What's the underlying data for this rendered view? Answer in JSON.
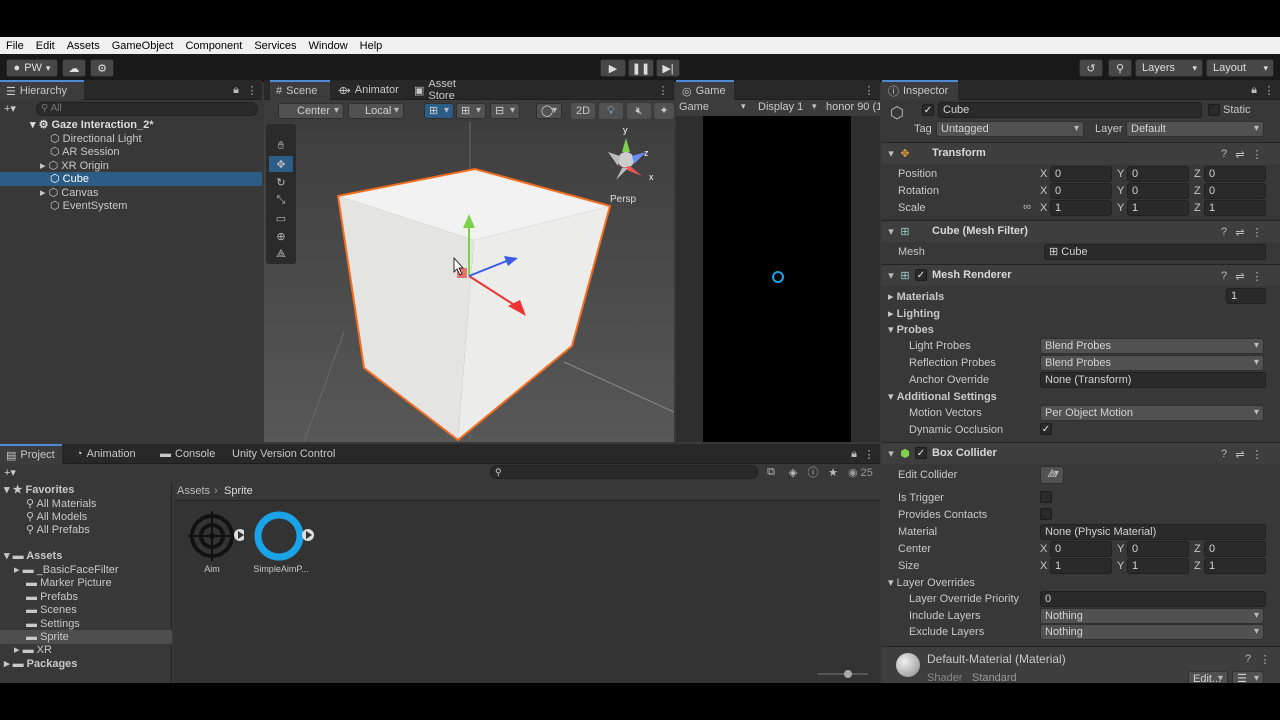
{
  "menu": [
    "File",
    "Edit",
    "Assets",
    "GameObject",
    "Component",
    "Services",
    "Window",
    "Help"
  ],
  "toolbar": {
    "account": "PW",
    "layers": "Layers",
    "layout": "Layout"
  },
  "hierarchy": {
    "tab": "Hierarchy",
    "search_placeholder": "All",
    "scene": "Gaze Interaction_2*",
    "items": [
      "Directional Light",
      "AR Session",
      "XR Origin",
      "Cube",
      "Canvas",
      "EventSystem"
    ]
  },
  "scene": {
    "tabs": [
      "Scene",
      "Animator",
      "Asset Store"
    ],
    "pivot": "Center",
    "space": "Local",
    "mode2d": "2D",
    "persp": "Persp",
    "axes": {
      "y": "y",
      "z": "z",
      "x": "x"
    }
  },
  "game": {
    "tab": "Game",
    "view": "Game",
    "display": "Display 1",
    "device": "honor 90 (1"
  },
  "inspector": {
    "tab": "Inspector",
    "name": "Cube",
    "static": "Static",
    "tag_label": "Tag",
    "tag": "Untagged",
    "layer_label": "Layer",
    "layer": "Default",
    "transform": {
      "title": "Transform",
      "rows": [
        {
          "label": "Position",
          "x": "0",
          "y": "0",
          "z": "0"
        },
        {
          "label": "Rotation",
          "x": "0",
          "y": "0",
          "z": "0"
        },
        {
          "label": "Scale",
          "x": "1",
          "y": "1",
          "z": "1"
        }
      ]
    },
    "mesh_filter": {
      "title": "Cube (Mesh Filter)",
      "mesh_label": "Mesh",
      "mesh": "Cube"
    },
    "mesh_renderer": {
      "title": "Mesh Renderer",
      "materials": "Materials",
      "materials_count": "1",
      "lighting": "Lighting",
      "probes": "Probes",
      "light_probes_label": "Light Probes",
      "light_probes": "Blend Probes",
      "reflection_probes_label": "Reflection Probes",
      "reflection_probes": "Blend Probes",
      "anchor_label": "Anchor Override",
      "anchor": "None (Transform)",
      "additional": "Additional Settings",
      "motion_label": "Motion Vectors",
      "motion": "Per Object Motion",
      "occlusion_label": "Dynamic Occlusion"
    },
    "box_collider": {
      "title": "Box Collider",
      "edit_label": "Edit Collider",
      "trigger_label": "Is Trigger",
      "contacts_label": "Provides Contacts",
      "material_label": "Material",
      "material": "None (Physic Material)",
      "center_label": "Center",
      "center": {
        "x": "0",
        "y": "0",
        "z": "0"
      },
      "size_label": "Size",
      "size": {
        "x": "1",
        "y": "1",
        "z": "1"
      },
      "overrides": "Layer Overrides",
      "priority_label": "Layer Override Priority",
      "priority": "0",
      "include_label": "Include Layers",
      "include": "Nothing",
      "exclude_label": "Exclude Layers",
      "exclude": "Nothing"
    },
    "material": {
      "title": "Default-Material (Material)",
      "shader_label": "Shader",
      "shader": "Standard",
      "edit": "Edit..."
    }
  },
  "project": {
    "tabs": [
      "Project",
      "Animation",
      "Console",
      "Unity Version Control"
    ],
    "favorites": "Favorites",
    "fav_items": [
      "All Materials",
      "All Models",
      "All Prefabs"
    ],
    "assets": "Assets",
    "asset_folders": [
      "_BasicFaceFilter",
      "Marker Picture",
      "Prefabs",
      "Scenes",
      "Settings",
      "Sprite",
      "XR"
    ],
    "packages": "Packages",
    "breadcrumb_root": "Assets",
    "breadcrumb_current": "Sprite",
    "files": [
      "Aim",
      "SimpleAimP..."
    ],
    "count": "25"
  },
  "colors": {
    "accent": "#4d8ad8",
    "selection": "#2c5d87",
    "selection_outline": "#f26d1f",
    "aim_ring": "#1aa3e6"
  }
}
